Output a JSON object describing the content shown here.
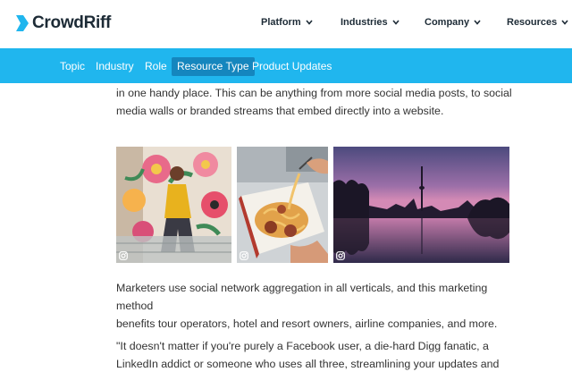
{
  "brand": {
    "name": "CrowdRiff",
    "color": "#20b6ee"
  },
  "main_nav": [
    {
      "label": "Platform"
    },
    {
      "label": "Industries"
    },
    {
      "label": "Company"
    },
    {
      "label": "Resources"
    }
  ],
  "sub_nav": {
    "items": [
      {
        "label": "Topic"
      },
      {
        "label": "Industry"
      },
      {
        "label": "Role"
      },
      {
        "label": "Resource Type",
        "active": true
      },
      {
        "label": "Product Updates"
      }
    ]
  },
  "article": {
    "intro_line1": "in one handy place. This can be anything from more social media posts, to social",
    "intro_line2": "media walls or branded streams that embed directly into a website.",
    "para2_line1": "Marketers use social network aggregation in all verticals, and this marketing method",
    "para2_line2": "benefits tour operators, hotel and resort owners, airline companies, and more.",
    "quote_line1": "\"It doesn't matter if you're purely a Facebook user, a die-hard Digg fanatic, a",
    "quote_line2": "LinkedIn addict or someone who uses all three, streamlining your updates and"
  },
  "photos": [
    {
      "icon": "instagram-icon",
      "subject": "mural-portrait"
    },
    {
      "icon": "instagram-icon",
      "subject": "spaghetti-dish"
    },
    {
      "icon": "instagram-icon",
      "subject": "city-skyline-dusk"
    }
  ]
}
